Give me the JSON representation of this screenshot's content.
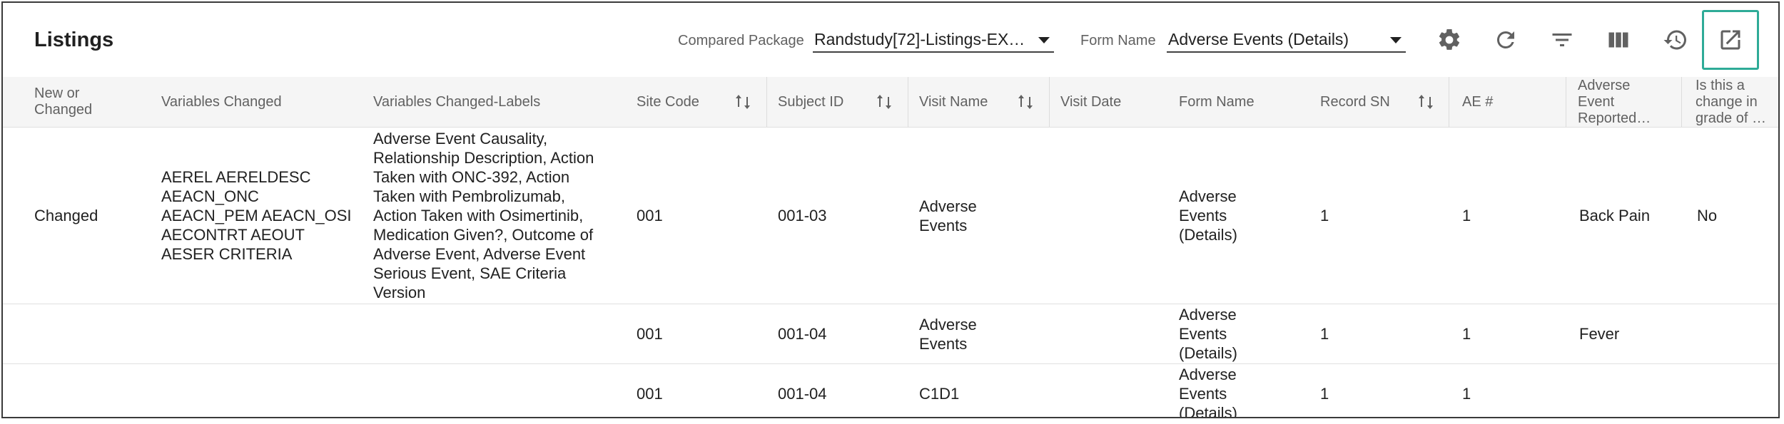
{
  "toolbar": {
    "title": "Listings",
    "compared_package_label": "Compared Package",
    "compared_package_value": "Randstudy[72]-Listings-EX…",
    "form_name_label": "Form Name",
    "form_name_value": "Adverse Events (Details)",
    "icons": [
      "gear-icon",
      "refresh-icon",
      "filter-icon",
      "columns-icon",
      "history-icon",
      "open-in-new-icon"
    ]
  },
  "table": {
    "headers": {
      "new_or_changed": "New or Changed",
      "variables_changed": "Variables Changed",
      "variables_changed_labels": "Variables Changed-Labels",
      "site_code": "Site Code",
      "subject_id": "Subject ID",
      "visit_name": "Visit Name",
      "visit_date": "Visit Date",
      "form_name": "Form Name",
      "record_sn": "Record SN",
      "ae_num": "AE #",
      "ae_reported": "Adverse Event Reported…",
      "grade_change": "Is this a change in grade of …"
    },
    "rows": [
      {
        "new_or_changed": "Changed",
        "variables_changed": "AEREL AERELDESC AEACN_ONC AEACN_PEM AEACN_OSI AECONTRT AEOUT AESER CRITERIA",
        "variables_changed_labels": "Adverse Event Causality, Relationship Description, Action Taken with ONC-392, Action Taken with Pembrolizumab, Action Taken with Osimertinib, Medication Given?, Outcome of Adverse Event, Adverse Event Serious Event, SAE Criteria Version",
        "site_code": "001",
        "subject_id": "001-03",
        "visit_name": "Adverse Events",
        "visit_date": "",
        "form_name": "Adverse Events (Details)",
        "record_sn": "1",
        "ae_num": "1",
        "ae_reported": "Back Pain",
        "grade_change": "No"
      },
      {
        "new_or_changed": "",
        "variables_changed": "",
        "variables_changed_labels": "",
        "site_code": "001",
        "subject_id": "001-04",
        "visit_name": "Adverse Events",
        "visit_date": "",
        "form_name": "Adverse Events (Details)",
        "record_sn": "1",
        "ae_num": "1",
        "ae_reported": "Fever",
        "grade_change": ""
      },
      {
        "new_or_changed": "",
        "variables_changed": "",
        "variables_changed_labels": "",
        "site_code": "001",
        "subject_id": "001-04",
        "visit_name": "C1D1",
        "visit_date": "",
        "form_name": "Adverse Events (Details)",
        "record_sn": "1",
        "ae_num": "1",
        "ae_reported": "",
        "grade_change": ""
      }
    ]
  }
}
